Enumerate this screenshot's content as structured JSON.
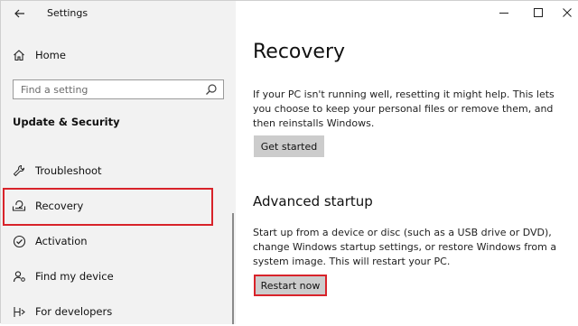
{
  "window": {
    "title": "Settings"
  },
  "sidebar": {
    "home_label": "Home",
    "search_placeholder": "Find a setting",
    "section_heading": "Update & Security",
    "items": [
      {
        "label": "Troubleshoot",
        "icon": "wrench-icon"
      },
      {
        "label": "Recovery",
        "icon": "recovery-icon",
        "selected": true
      },
      {
        "label": "Activation",
        "icon": "check-circle-icon"
      },
      {
        "label": "Find my device",
        "icon": "person-location-icon"
      },
      {
        "label": "For developers",
        "icon": "developer-tools-icon"
      }
    ]
  },
  "main": {
    "title": "Recovery",
    "reset": {
      "description": "If your PC isn't running well, resetting it might help. This lets you choose to keep your personal files or remove them, and then reinstalls Windows.",
      "button_label": "Get started"
    },
    "advanced": {
      "title": "Advanced startup",
      "description": "Start up from a device or disc (such as a USB drive or DVD), change Windows startup settings, or restore Windows from a system image. This will restart your PC.",
      "button_label": "Restart now"
    }
  },
  "colors": {
    "highlight": "#d8232a",
    "sidebar_bg": "#f2f2f2",
    "button_bg": "#cccccc"
  }
}
